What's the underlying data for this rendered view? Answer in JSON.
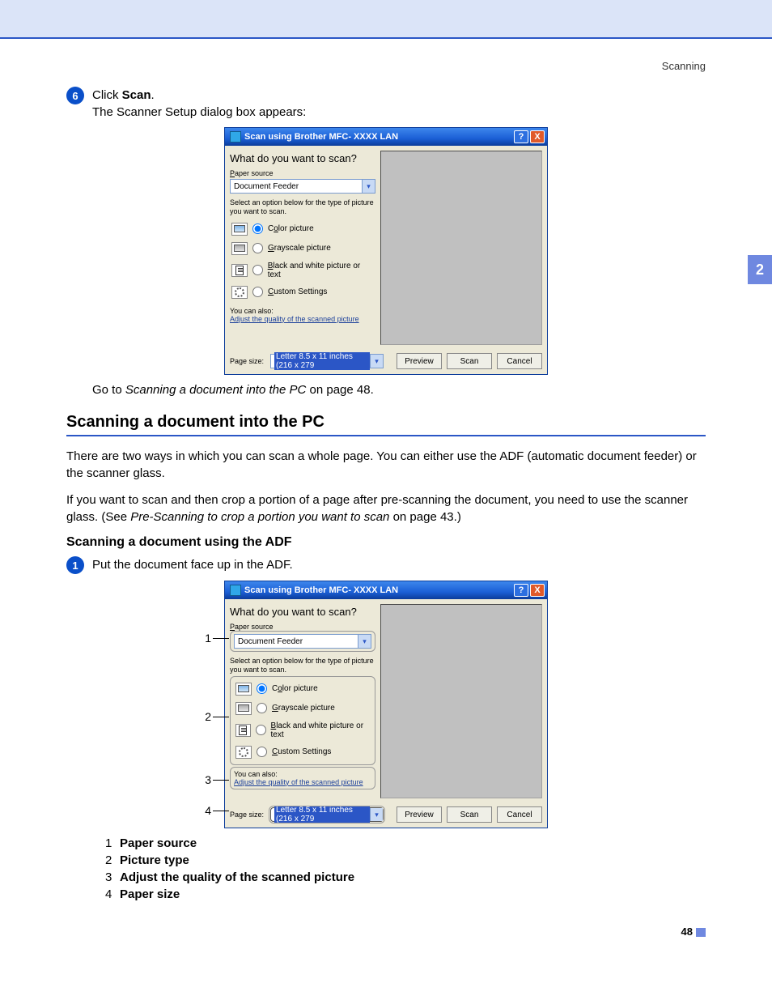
{
  "header": {
    "running": "Scanning"
  },
  "sidetab": "2",
  "step6": {
    "num": "6",
    "line1a": "Click ",
    "line1b": "Scan",
    "line1c": ".",
    "line2": "The Scanner Setup dialog box appears:"
  },
  "dialog": {
    "title": "Scan using Brother MFC- XXXX  LAN",
    "heading": "What do you want to scan?",
    "paper_source_label": "Paper source",
    "paper_source_value": "Document Feeder",
    "hint": "Select an option below for the type of picture you want to scan.",
    "opts": {
      "color": "Color picture",
      "gray": "Grayscale picture",
      "bw": "Black and white picture or text",
      "custom": "Custom Settings"
    },
    "youcan": "You can also:",
    "adjust": "Adjust the quality of the scanned picture",
    "page_size_label": "Page size:",
    "page_size_value": "Letter 8.5 x 11 inches (216 x 279",
    "buttons": {
      "preview": "Preview",
      "scan": "Scan",
      "cancel": "Cancel"
    }
  },
  "goto": {
    "a": "Go to ",
    "b": "Scanning a document into the PC",
    "c": " on page 48."
  },
  "section_title": "Scanning a document into the PC",
  "para1": "There are two ways in which you can scan a whole page. You can either use the ADF (automatic document feeder) or the scanner glass.",
  "para2a": "If you want to scan and then crop a portion of a page after pre-scanning the document, you need to use the scanner glass. (See ",
  "para2b": "Pre-Scanning to crop a portion you want to scan",
  "para2c": " on page 43.)",
  "sub_title": "Scanning a document using the ADF",
  "step1": {
    "num": "1",
    "text": "Put the document face up in the ADF."
  },
  "callouts": {
    "c1": "1",
    "c2": "2",
    "c3": "3",
    "c4": "4"
  },
  "legend": [
    {
      "n": "1",
      "t": "Paper source"
    },
    {
      "n": "2",
      "t": "Picture type"
    },
    {
      "n": "3",
      "t": "Adjust the quality of the scanned picture"
    },
    {
      "n": "4",
      "t": "Paper size"
    }
  ],
  "footer": {
    "page": "48"
  }
}
